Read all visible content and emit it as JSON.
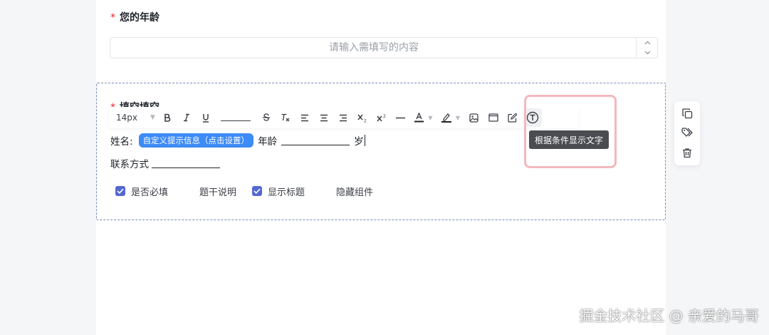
{
  "question1": {
    "required_mark": "*",
    "label": "您的年龄",
    "input_value": "",
    "placeholder": "请输入需填写的内容"
  },
  "question2": {
    "required_mark": "*",
    "title_partial": "填空填空",
    "toolbar": {
      "font_size": "14px"
    },
    "tooltip": "根据条件显示文字",
    "line1": {
      "name_label": "姓名:",
      "hint_tag": "自定义提示信息（点击设置）",
      "age_label": "年龄",
      "age_suffix": "岁"
    },
    "line2": {
      "contact_label": "联系方式"
    },
    "options": [
      {
        "label": "是否必填",
        "checked": true
      },
      {
        "label": "题干说明",
        "checked": false
      },
      {
        "label": "显示标题",
        "checked": true
      },
      {
        "label": "隐藏组件",
        "checked": false
      }
    ]
  },
  "colors": {
    "accent": "#5468d4",
    "tag_blue": "#3d8bf6",
    "required": "#f5222d",
    "highlight": "#f3b8bd",
    "tooltip_bg": "#4a4c51"
  },
  "watermark": "掘金技术社区 @ 亲爱的马哥"
}
